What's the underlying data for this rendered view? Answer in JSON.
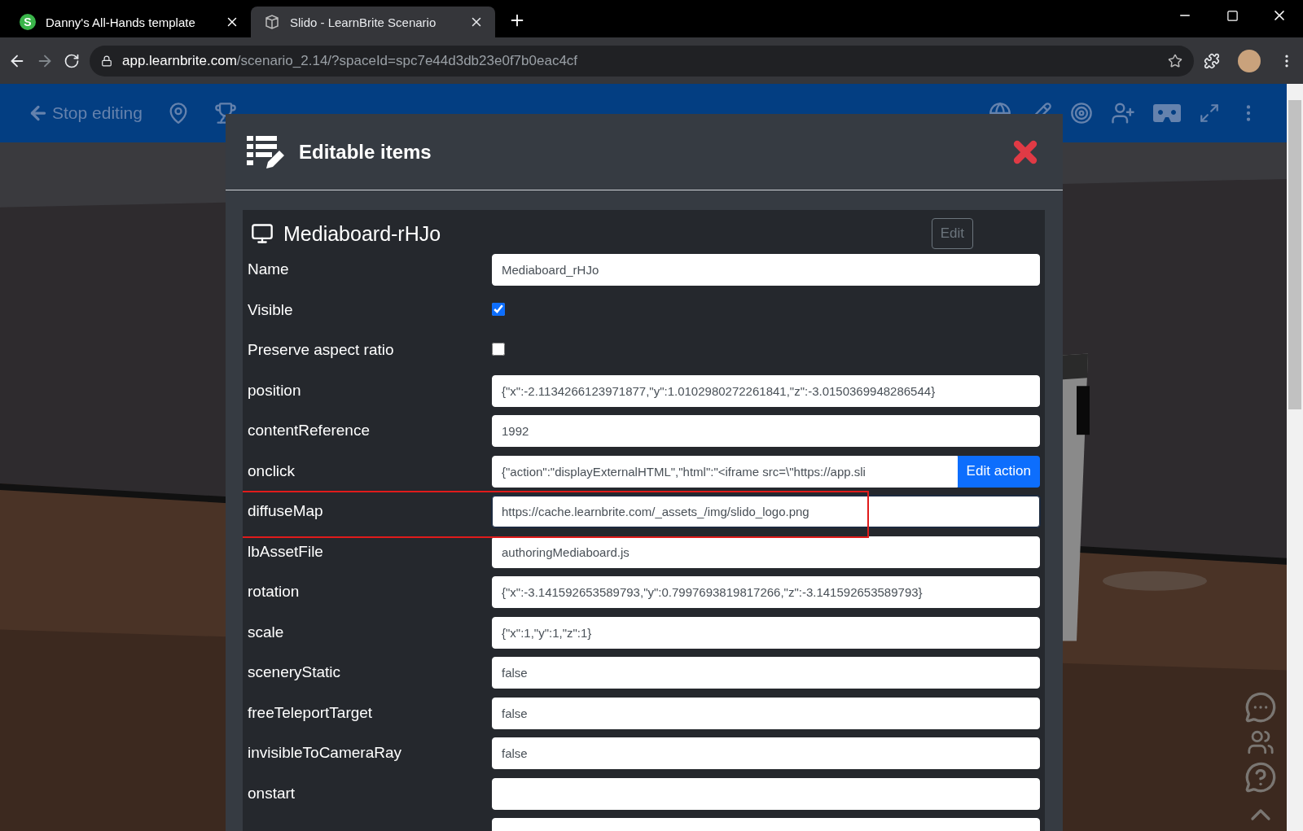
{
  "browser": {
    "tabs": [
      {
        "title": "Danny's All-Hands template",
        "favicon": "S",
        "selected": false
      },
      {
        "title": "Slido - LearnBrite Scenario",
        "selected": true
      }
    ],
    "address": {
      "host": "app.learnbrite.com",
      "path": "/scenario_2.14/?spaceId=spc7e44d3db23e0f7b0eac4cf"
    }
  },
  "toolbar": {
    "stop_editing": "Stop editing"
  },
  "modal": {
    "title": "Editable items",
    "item": {
      "title": "Mediaboard-rHJo",
      "edit_button": "Edit",
      "edit_disabled": true,
      "fields": [
        {
          "kind": "text",
          "label": "Name",
          "value": "Mediaboard_rHJo",
          "focused": false
        },
        {
          "kind": "checkbox",
          "label": "Visible",
          "checked": true
        },
        {
          "kind": "checkbox",
          "label": "Preserve aspect ratio",
          "checked": false
        },
        {
          "kind": "text",
          "label": "position",
          "value": "{\"x\":-2.1134266123971877,\"y\":1.0102980272261841,\"z\":-3.0150369948286544}",
          "focused": false
        },
        {
          "kind": "text",
          "label": "contentReference",
          "value": "1992",
          "focused": false
        },
        {
          "kind": "action",
          "label": "onclick",
          "value": "{\"action\":\"displayExternalHTML\",\"html\":\"<iframe src=\\\"https://app.sli",
          "button": "Edit action",
          "focused": false
        },
        {
          "kind": "text",
          "label": "diffuseMap",
          "value": "https://cache.learnbrite.com/_assets_/img/slido_logo.png",
          "focused": true,
          "highlighted": true
        },
        {
          "kind": "text",
          "label": "lbAssetFile",
          "value": "authoringMediaboard.js",
          "focused": false
        },
        {
          "kind": "text",
          "label": "rotation",
          "value": "{\"x\":-3.141592653589793,\"y\":0.7997693819817266,\"z\":-3.141592653589793}",
          "focused": false
        },
        {
          "kind": "text",
          "label": "scale",
          "value": "{\"x\":1,\"y\":1,\"z\":1}",
          "focused": false
        },
        {
          "kind": "text",
          "label": "sceneryStatic",
          "value": "false",
          "focused": false
        },
        {
          "kind": "text",
          "label": "freeTeleportTarget",
          "value": "false",
          "focused": false
        },
        {
          "kind": "text",
          "label": "invisibleToCameraRay",
          "value": "false",
          "focused": false
        },
        {
          "kind": "text",
          "label": "onstart",
          "focused": false
        },
        {
          "kind": "text",
          "focused": false
        }
      ]
    }
  }
}
